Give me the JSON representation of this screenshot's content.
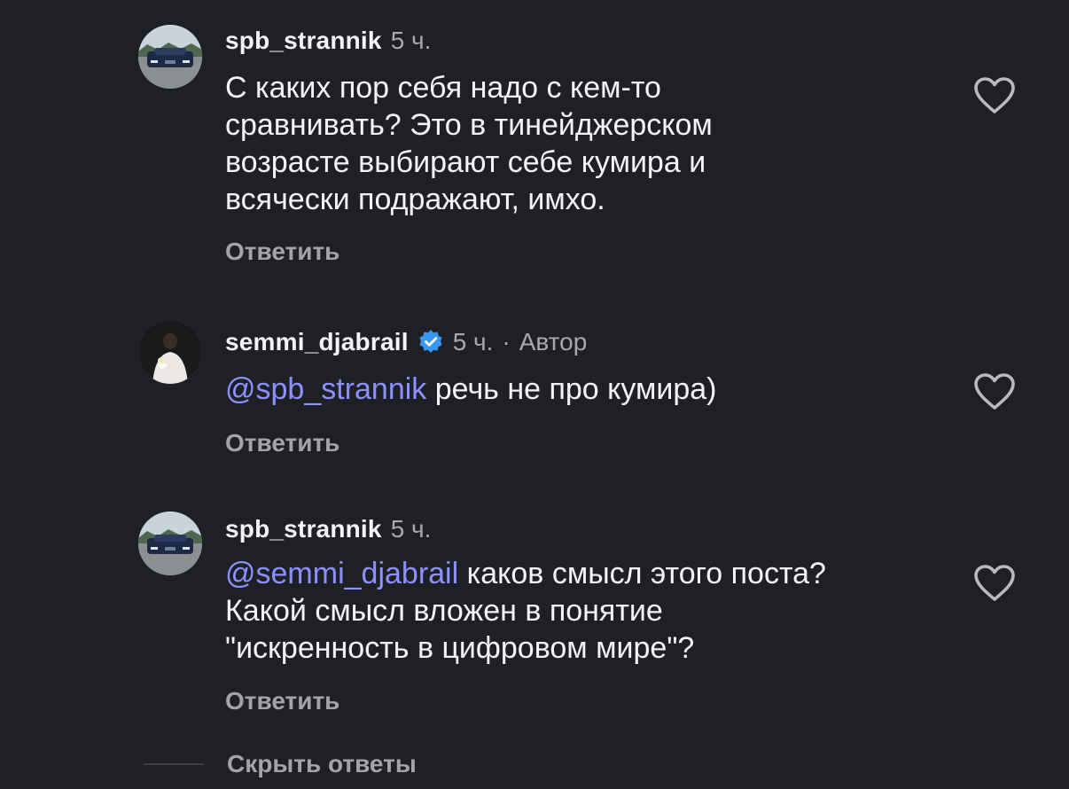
{
  "comments": [
    {
      "username": "spb_strannik",
      "time": "5 ч.",
      "mention": "",
      "text_lines": [
        "С каких пор себя надо с кем-то",
        "сравнивать? Это в тинейджерском",
        "возрасте выбирают себе кумира и",
        "всячески подражают, имхо."
      ],
      "reply_label": "Ответить",
      "avatar_icon": "car-photo"
    },
    {
      "username": "semmi_djabrail",
      "time": "5 ч.",
      "author_label": "Автор",
      "separator": "·",
      "verified_icon": "verified-badge-icon",
      "mention": "@spb_strannik",
      "text_lines": [
        "речь не про кумира)"
      ],
      "reply_label": "Ответить",
      "avatar_icon": "person-photo"
    },
    {
      "username": "spb_strannik",
      "time": "5 ч.",
      "mention": "@semmi_djabrail",
      "text_lines": [
        "каков смысл этого поста?",
        "Какой смысл вложен в понятие",
        "\"искренность в цифровом мире\"?"
      ],
      "reply_label": "Ответить",
      "avatar_icon": "car-photo"
    }
  ],
  "hide_replies_label": "Скрыть ответы",
  "colors": {
    "background": "#1f2026",
    "mention": "#8c91ff",
    "verified": "#3897f0",
    "muted": "#a8a9b0"
  }
}
